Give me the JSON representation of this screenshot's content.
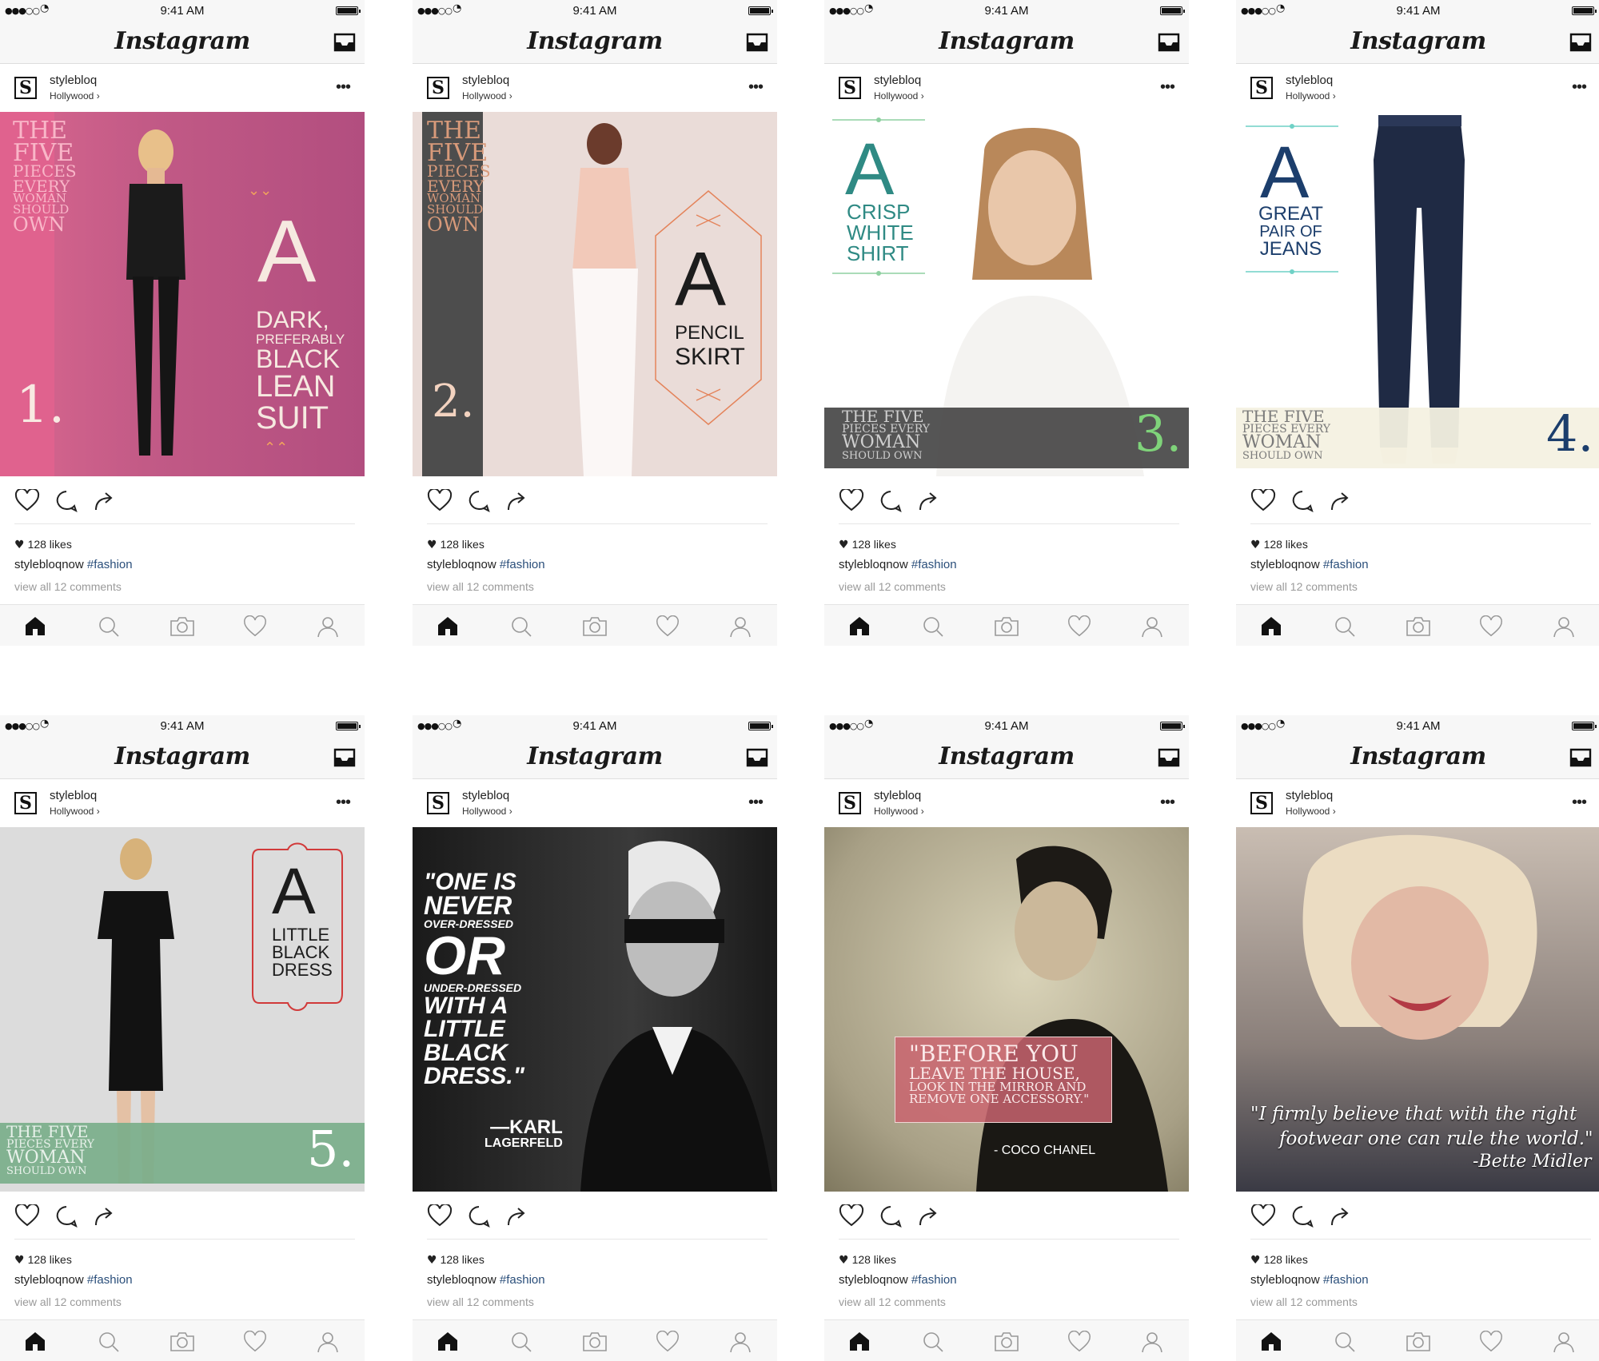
{
  "status_bar": {
    "signal": "●●●○○",
    "time": "9:41 AM"
  },
  "app": {
    "logo": "Instagram"
  },
  "post_common": {
    "username": "stylebloq",
    "location": "Hollywood ›",
    "avatar_letter": "S",
    "more": "•••",
    "likes": "128 likes",
    "caption_user": "stylebloqnow",
    "caption_tag": "#fashion",
    "comments": "view all 12 comments"
  },
  "series_label": {
    "the": "THE",
    "five": "FIVE",
    "pieces": "PIECES",
    "every": "EVERY",
    "woman": "WOMAN",
    "should": "SHOULD",
    "own": "OWN",
    "line1": "THE FIVE",
    "line2": "PIECES EVERY",
    "line3": "WOMAN",
    "line4": "SHOULD OWN"
  },
  "posts": [
    {
      "number": "1.",
      "big": "A",
      "lines": [
        "DARK,",
        "PREFERABLY",
        "BLACK",
        "LEAN",
        "SUIT"
      ]
    },
    {
      "number": "2.",
      "big": "A",
      "lines": [
        "PENCIL",
        "SKIRT"
      ]
    },
    {
      "number": "3.",
      "big": "A",
      "lines": [
        "CRISP",
        "WHITE",
        "SHIRT"
      ]
    },
    {
      "number": "4.",
      "big": "A",
      "lines": [
        "GREAT",
        "PAIR OF",
        "JEANS"
      ]
    },
    {
      "number": "5.",
      "big": "A",
      "lines": [
        "LITTLE",
        "BLACK",
        "DRESS"
      ]
    },
    {
      "quote_lines": [
        "\"ONE IS",
        "NEVER",
        "OVER-DRESSED",
        "OR",
        "UNDER-DRESSED",
        "WITH A",
        "LITTLE",
        "BLACK",
        "DRESS.\""
      ],
      "author_1": "—KARL",
      "author_2": "LAGERFELD"
    },
    {
      "quote_lines": [
        "\"BEFORE YOU",
        "LEAVE THE HOUSE,",
        "LOOK IN THE MIRROR AND",
        "REMOVE ONE ACCESSORY.\""
      ],
      "author": "- COCO CHANEL"
    },
    {
      "quote_lines": [
        "\"I firmly believe that with the right",
        "footwear one can rule the world.\""
      ],
      "author": "-Bette Midler"
    }
  ],
  "colors": {
    "tab_bg": "#f7f7f7",
    "hashtag": "#2a4e7a",
    "post1_bg": "#c25a86",
    "post3_accent": "#2f8a84",
    "post4_accent": "#1c3e6c",
    "post5_accent": "#d13a3a",
    "post7_box": "#c9646e"
  },
  "icons": [
    "inbox-icon",
    "heart-icon",
    "comment-icon",
    "share-icon",
    "home-icon",
    "search-icon",
    "camera-icon",
    "activity-heart-icon",
    "profile-icon"
  ]
}
